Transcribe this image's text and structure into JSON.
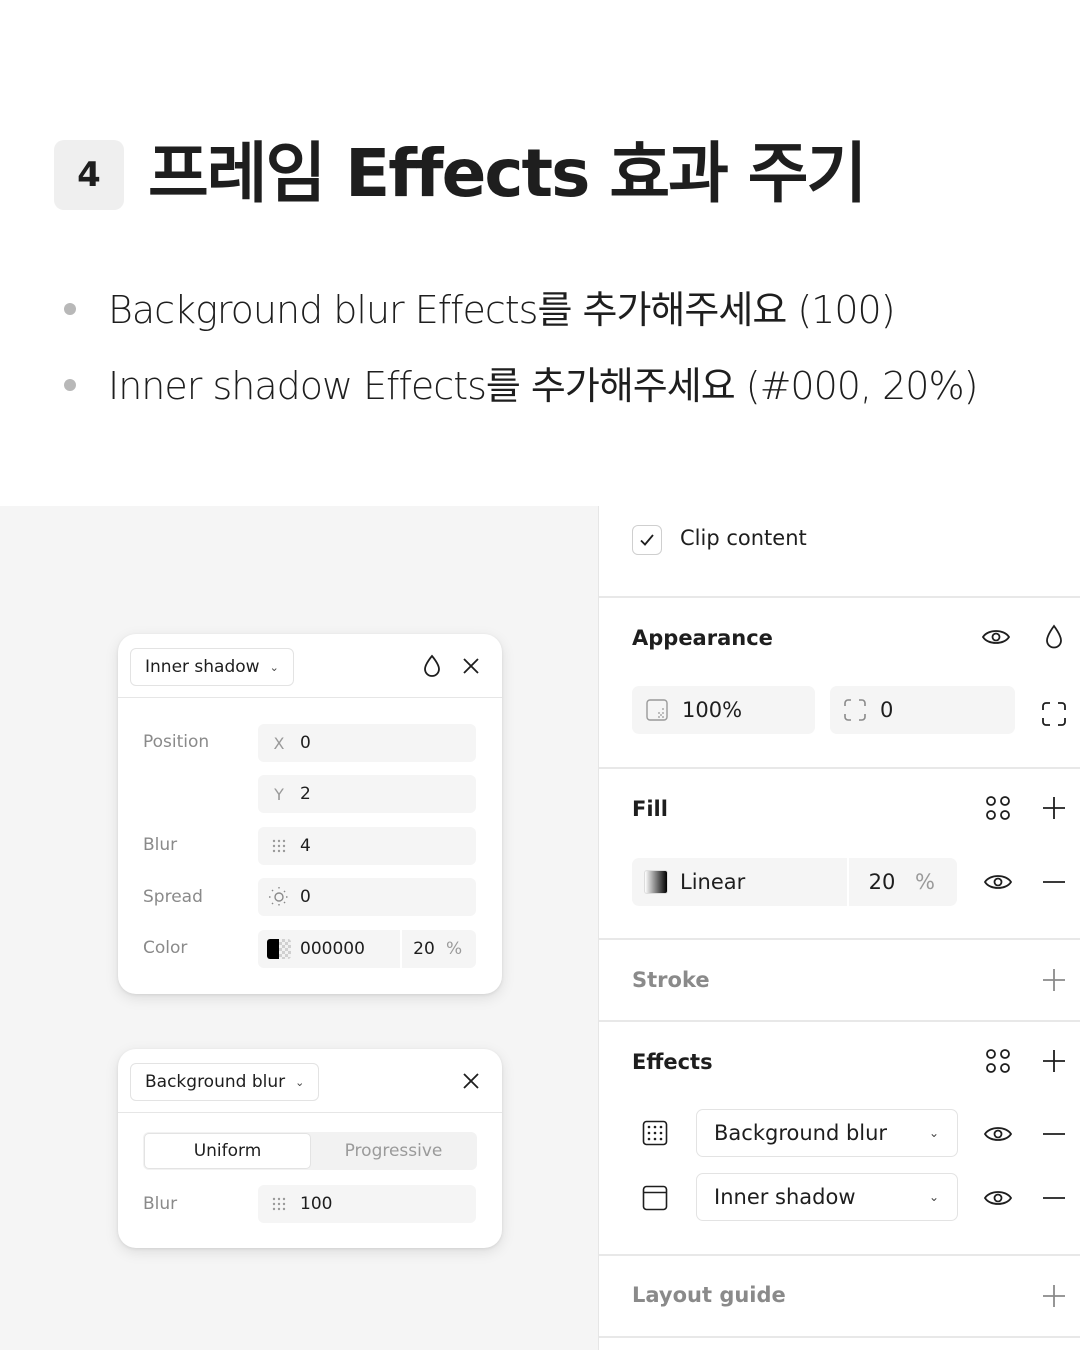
{
  "header": {
    "step_number": "4",
    "title": "프레임 Effects 효과 주기",
    "bullets": [
      "Background blur Effects를 추가해주세요 (100)",
      "Inner shadow Effects를 추가해주세요 (#000, 20%)"
    ]
  },
  "inner_shadow_card": {
    "type": "Inner shadow",
    "position_label": "Position",
    "x_label": "X",
    "x_value": "0",
    "y_label": "Y",
    "y_value": "2",
    "blur_label": "Blur",
    "blur_value": "4",
    "spread_label": "Spread",
    "spread_value": "0",
    "color_label": "Color",
    "color_hex": "000000",
    "color_opacity": "20",
    "percent": "%"
  },
  "background_blur_card": {
    "type": "Background blur",
    "tab_uniform": "Uniform",
    "tab_progressive": "Progressive",
    "active_tab": "Uniform",
    "blur_label": "Blur",
    "blur_value": "100"
  },
  "panel": {
    "clip_content_label": "Clip content",
    "clip_content_checked": true,
    "appearance": {
      "title": "Appearance",
      "opacity": "100%",
      "corner_radius": "0"
    },
    "fill": {
      "title": "Fill",
      "type": "Linear",
      "opacity": "20",
      "percent": "%"
    },
    "stroke": {
      "title": "Stroke"
    },
    "effects": {
      "title": "Effects",
      "items": [
        {
          "label": "Background blur",
          "icon": "background-blur-icon"
        },
        {
          "label": "Inner shadow",
          "icon": "inner-shadow-icon"
        }
      ]
    },
    "layout_guide": {
      "title": "Layout guide"
    }
  },
  "colors": {
    "canvas_bg": "#f5f5f5",
    "muted_text": "#8a8a8a",
    "divider": "#e8e8e8"
  }
}
